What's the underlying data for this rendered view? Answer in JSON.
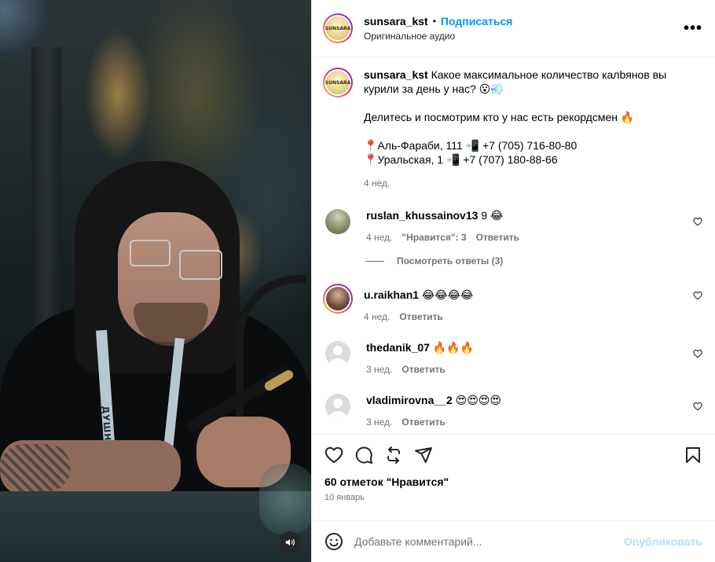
{
  "media": {
    "lanyard_text": "ДУШНИЛА",
    "volume_icon": "volume-icon"
  },
  "header": {
    "username": "sunsara_kst",
    "separator": "•",
    "follow_label": "Подписаться",
    "audio_label": "Оригинальное аудио",
    "more_label": "•••",
    "avatar_text": "SUNSARA"
  },
  "caption": {
    "username": "sunsara_kst",
    "line1": "Какое максимальное количество калbянов вы курили за день у нас? 😮💨",
    "line2": "Делитесь и посмотрим кто у нас есть рекордсмен 🔥",
    "line3": "📍Аль-Фараби, 111 📲 +7 (705) 716-80-80",
    "line4": "📍Уральская, 1 📲 +7 (707) 180-88-66",
    "time": "4 нед."
  },
  "comments": [
    {
      "username": "ruslan_khussainov13",
      "text": "9 😂",
      "time": "4 нед.",
      "likes": "\"Нравится\": 3",
      "reply": "Ответить",
      "view_replies": "Посмотреть ответы (3)"
    },
    {
      "username": "u.raikhan1",
      "text": "😂😂😂😂",
      "time": "4 нед.",
      "reply": "Ответить"
    },
    {
      "username": "thedanik_07",
      "text": "🔥🔥🔥",
      "time": "3 нед.",
      "reply": "Ответить"
    },
    {
      "username": "vladimirovna__2",
      "text": "😍😍😍😍",
      "time": "3 нед.",
      "reply": "Ответить"
    }
  ],
  "actions": {
    "likes": "60 отметок \"Нравится\"",
    "date": "10 январь"
  },
  "add_comment": {
    "placeholder": "Добавьте комментарий...",
    "publish_label": "Опубликовать"
  },
  "colors": {
    "accent": "#0095f6",
    "publish_disabled": "#b2dffc",
    "muted": "#737373"
  }
}
